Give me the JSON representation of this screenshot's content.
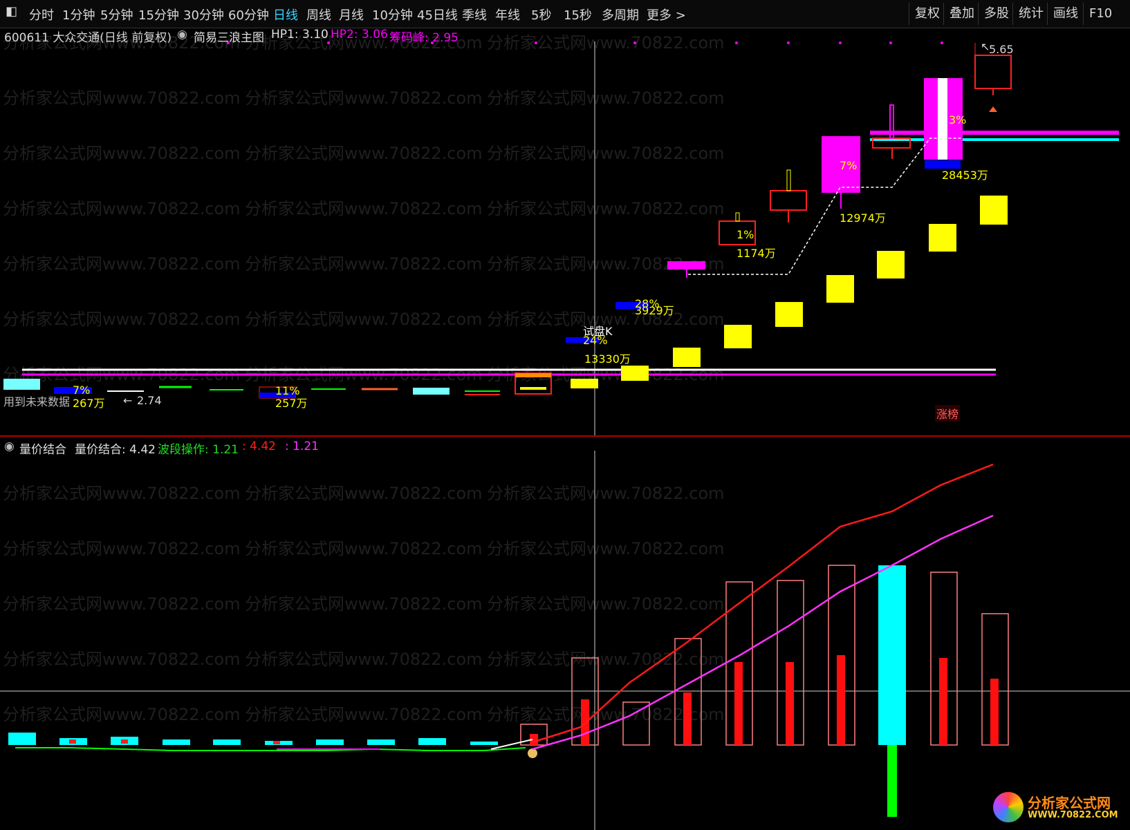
{
  "toolbar": {
    "items": [
      "分时",
      "1分钟",
      "5分钟",
      "15分钟",
      "30分钟",
      "60分钟",
      "日线",
      "周线",
      "月线",
      "10分钟",
      "45日线",
      "季线",
      "年线",
      "5秒",
      "15秒",
      "多周期",
      "更多 >"
    ],
    "active": "日线",
    "right_items": [
      "复权",
      "叠加",
      "多股",
      "统计",
      "画线",
      "F10"
    ]
  },
  "main_panel": {
    "title": "600611 大众交通(日线 前复权)",
    "indicator_name": "简易三浪主图",
    "hp1_label": "HP1: 3.10",
    "hp2_label": "HP2: 3.06",
    "chip_peak_label": "筹码峰: 2.95",
    "annotations": {
      "high_price": "5.65",
      "low_price": "2.74",
      "future_data": "用到未来数据",
      "trial_k": "试盘K",
      "limit_up": "涨榜",
      "pct_7_left": "7%",
      "vol_267": "267万",
      "pct_11": "11%",
      "vol_257": "257万",
      "vol_13330": "13330万",
      "pct_24": "24%",
      "pct_28": "28%",
      "vol_3929": "3929万",
      "pct_1": "1%",
      "vol_1174": "1174万",
      "pct_7_mid": "7%",
      "vol_12974": "12974万",
      "pct_3": "3%",
      "vol_28453": "28453万"
    },
    "colors": {
      "yellow": "#ffff00",
      "magenta": "#ff00ff",
      "cyan": "#00ffff",
      "blue": "#0000ff",
      "red": "#ff2020",
      "white": "#ffffff"
    }
  },
  "sub_panel": {
    "indicator_name": "量价结合",
    "value_label": "量价结合: 4.42",
    "wave_label": "波段操作: 1.21",
    "val_red": ": 4.42",
    "val_magenta": ": 1.21"
  },
  "watermark": "分析家公式网www.70822.com",
  "logo": {
    "title": "分析家公式网",
    "url": "WWW.70822.COM"
  }
}
